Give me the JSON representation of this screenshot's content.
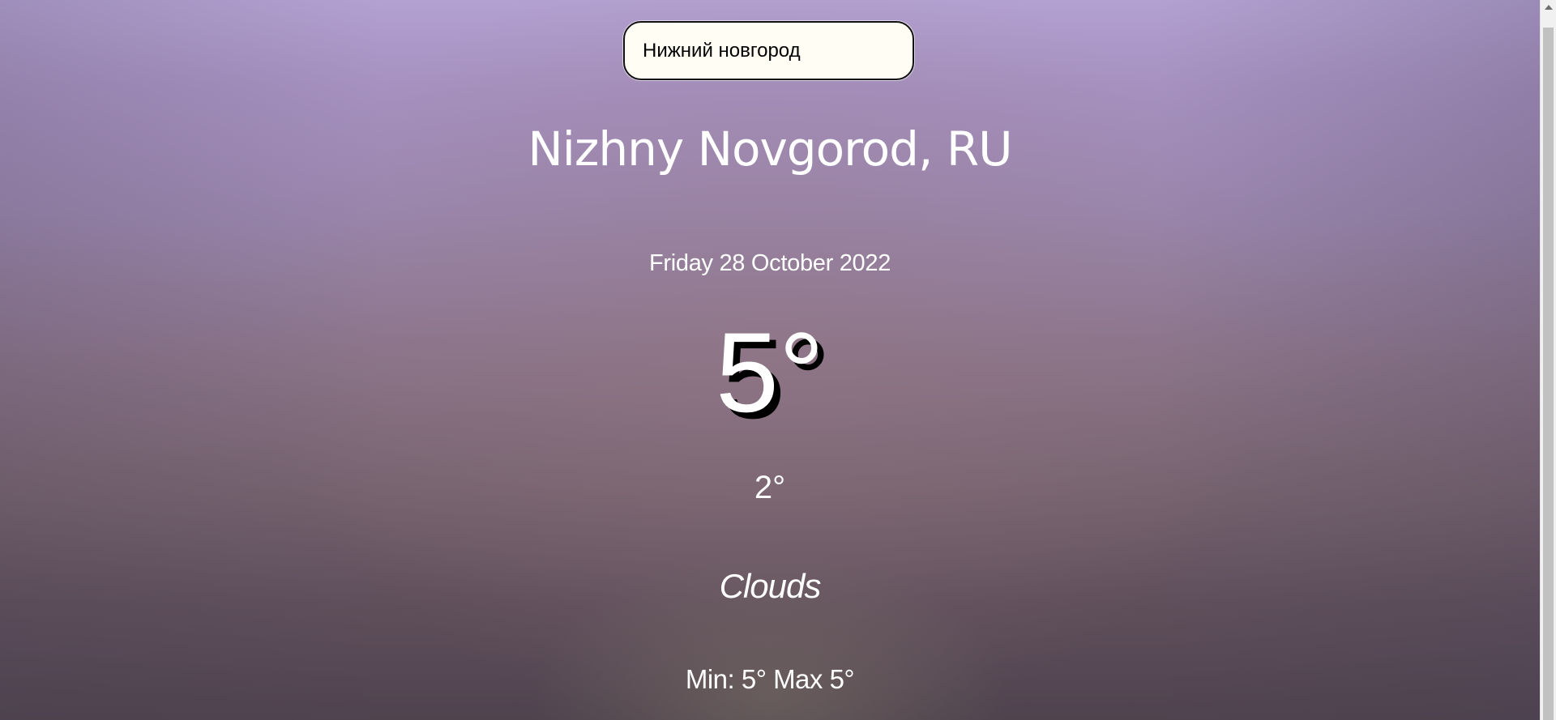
{
  "search": {
    "value": "Нижний новгород"
  },
  "location": {
    "label": "Nizhny Novgorod, RU"
  },
  "date": "Friday 28 October 2022",
  "temperature": {
    "current": "5°",
    "feels_like": "2°",
    "condition": "Clouds",
    "min_max": "Min: 5° Max 5°"
  },
  "scrollbar": {
    "up_icon": "triangle-up-icon"
  }
}
